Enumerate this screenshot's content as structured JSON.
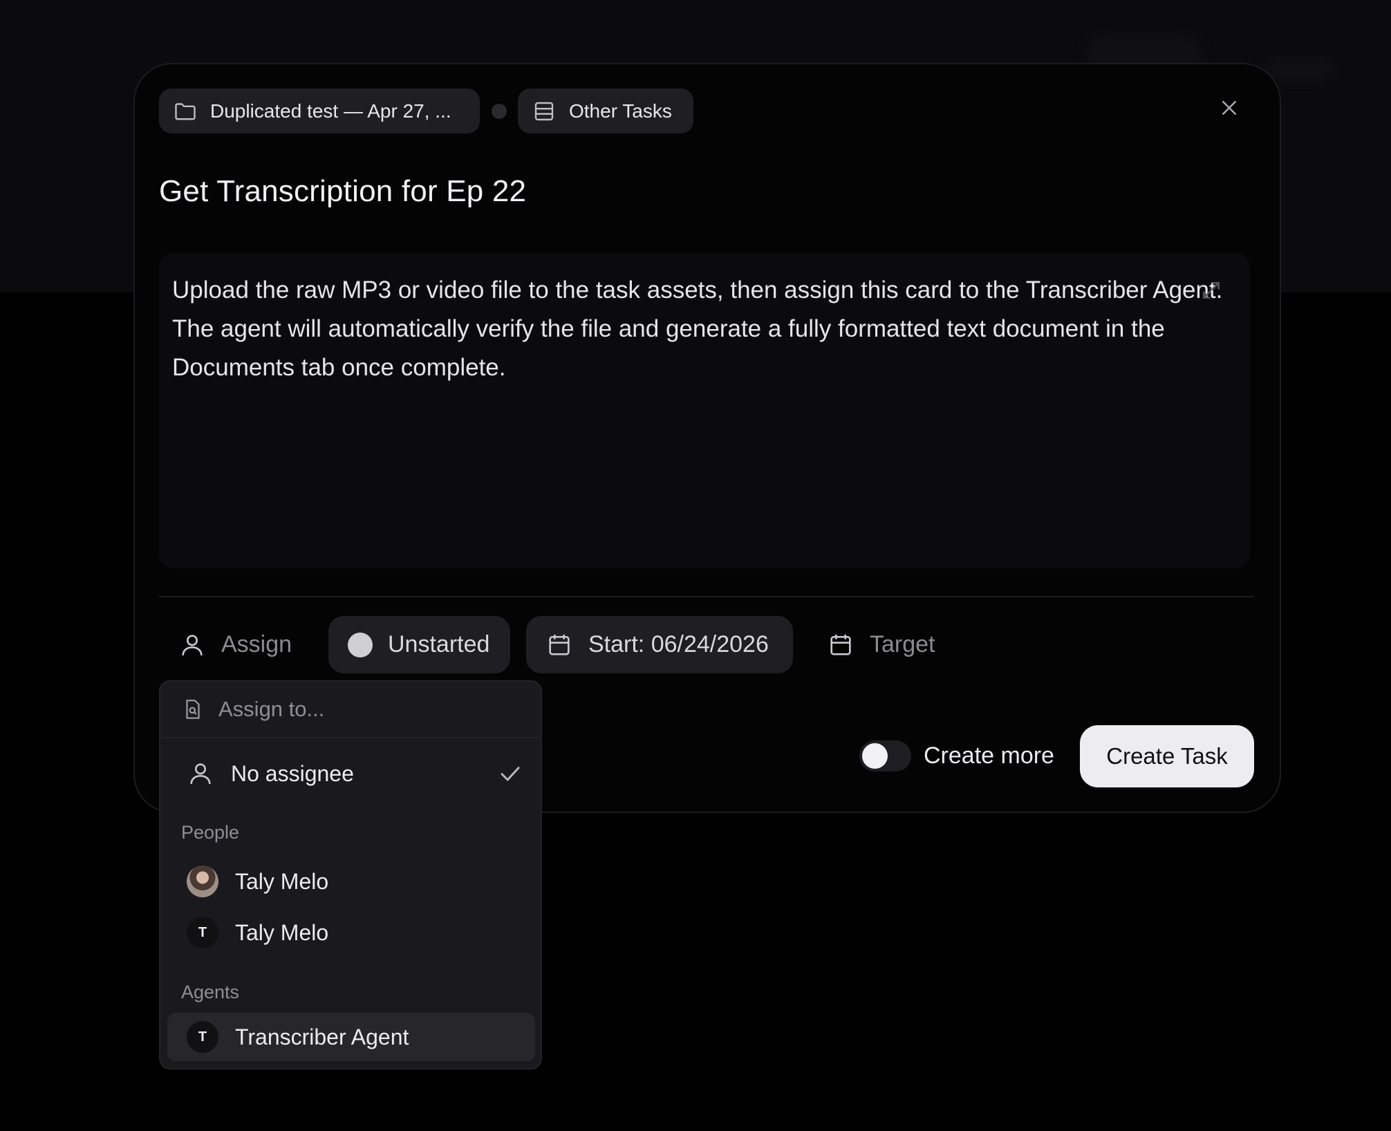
{
  "modal": {
    "breadcrumb": {
      "project_label": "Duplicated test — Apr 27, ...",
      "list_label": "Other Tasks"
    },
    "title": "Get Transcription for Ep 22",
    "description": "Upload the raw MP3 or video file to the task assets, then assign this card to the Transcriber Agent. The agent will automatically verify the file and generate a fully formatted text document in the Documents tab once complete.",
    "properties": {
      "assign_label": "Assign",
      "status_label": "Unstarted",
      "start_label": "Start: 06/24/2026",
      "target_label": "Target"
    },
    "footer": {
      "create_more_label": "Create more",
      "create_more_enabled": false,
      "create_button_label": "Create Task"
    }
  },
  "assign_dropdown": {
    "search_placeholder": "Assign to...",
    "no_assignee_label": "No assignee",
    "no_assignee_selected": true,
    "people_heading": "People",
    "people": [
      {
        "name": "Taly Melo",
        "avatar": "photo"
      },
      {
        "name": "Taly Melo",
        "avatar": "T"
      }
    ],
    "agents_heading": "Agents",
    "agents": [
      {
        "name": "Transcriber Agent",
        "avatar": "T"
      }
    ]
  },
  "icons": {
    "folder": "folder-icon",
    "list": "list-icon",
    "close": "close-icon",
    "person": "person-icon",
    "calendar": "calendar-icon",
    "search_file": "file-search-icon",
    "check": "check-icon"
  },
  "colors": {
    "background": "#000000",
    "modal": "#040405",
    "chip": "#1f1f23",
    "dropdown": "#1a1a1e",
    "primary_button": "#ececf1"
  }
}
